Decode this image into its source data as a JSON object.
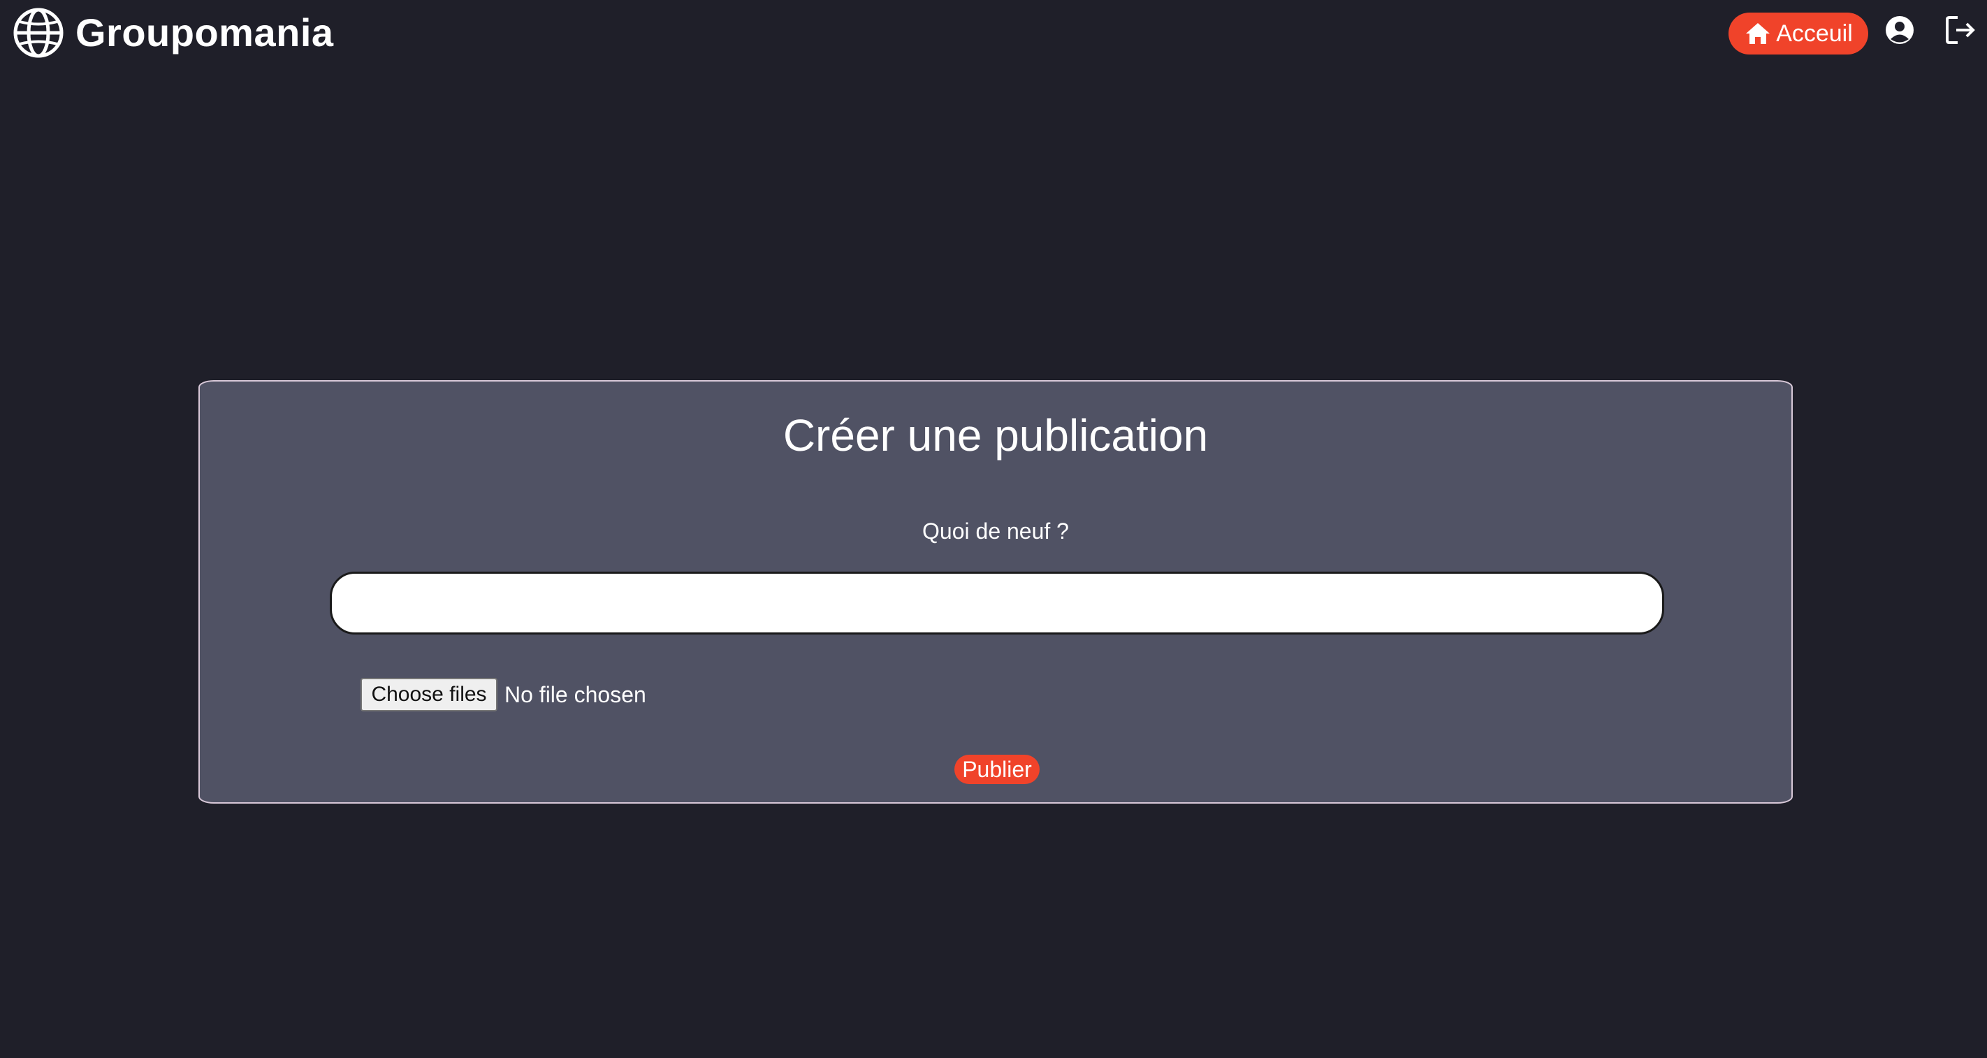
{
  "header": {
    "brand": "Groupomania",
    "logo_icon": "globe-icon",
    "nav": {
      "home_label": "Acceuil",
      "home_icon": "home-icon",
      "profile_icon": "user-circle-icon",
      "logout_icon": "logout-icon"
    }
  },
  "main": {
    "title": "Créer une publication",
    "prompt_label": "Quoi de neuf ?",
    "post_input": {
      "value": "",
      "placeholder": ""
    },
    "file_picker": {
      "button_label": "Choose files",
      "status": "No file chosen"
    },
    "submit_label": "Publier"
  },
  "colors": {
    "background": "#1f1f29",
    "card": "#505264",
    "accent": "#f0432a",
    "text": "#ffffff"
  }
}
